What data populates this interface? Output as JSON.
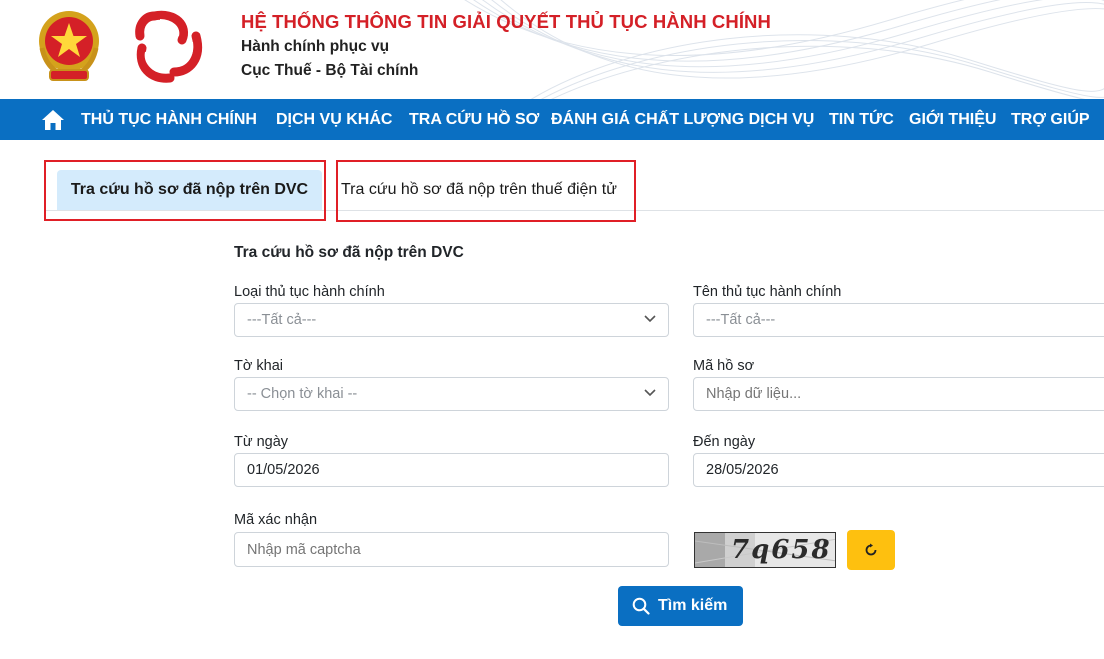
{
  "header": {
    "title": "HỆ THỐNG THÔNG TIN GIẢI QUYẾT THỦ TỤC HÀNH CHÍNH",
    "subtitle_1": "Hành chính phục vụ",
    "subtitle_2": "Cục Thuế - Bộ Tài chính",
    "emblem_icon": "national-emblem-icon",
    "logo_icon": "public-service-logo-icon",
    "title_color": "#d42027"
  },
  "nav": {
    "background": "#0a6fc2",
    "home_icon": "home-icon",
    "items": [
      "THỦ TỤC HÀNH CHÍNH",
      "DỊCH VỤ KHÁC",
      "TRA CỨU HỒ SƠ",
      "ĐÁNH GIÁ CHẤT LƯỢNG DỊCH VỤ",
      "TIN TỨC",
      "GIỚI THIỆU",
      "TRỢ GIÚP"
    ]
  },
  "tabs": {
    "active": "Tra cứu hồ sơ đã nộp trên DVC",
    "inactive": "Tra cứu hồ sơ đã nộp trên thuế điện tử",
    "highlight_color": "#e01f26"
  },
  "form": {
    "title": "Tra cứu hồ sơ đã nộp trên DVC",
    "procedure_type": {
      "label": "Loại thủ tục hành chính",
      "value": "---Tất cả---"
    },
    "procedure_name": {
      "label": "Tên thủ tục hành chính",
      "value": "---Tất cả---"
    },
    "declaration": {
      "label": "Tờ khai",
      "value": "-- Chọn tờ khai --"
    },
    "file_code": {
      "label": "Mã hồ sơ",
      "placeholder": "Nhập dữ liệu..."
    },
    "from_date": {
      "label": "Từ ngày",
      "value": "01/05/2026"
    },
    "to_date": {
      "label": "Đến ngày",
      "value": "28/05/2026"
    },
    "captcha": {
      "label": "Mã xác nhận",
      "placeholder": "Nhập mã captcha",
      "image_text": "7q658"
    },
    "refresh_icon": "refresh-icon",
    "search_button": "Tìm kiếm",
    "search_icon": "search-icon"
  }
}
